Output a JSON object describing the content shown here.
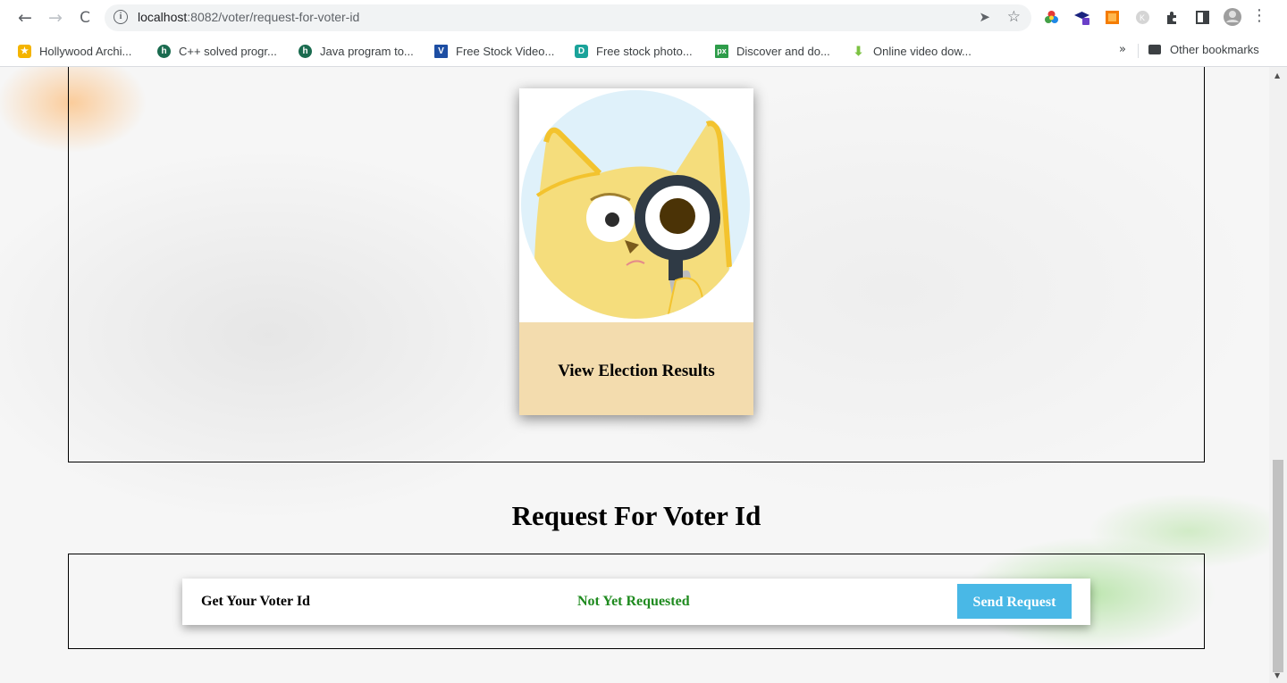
{
  "browser": {
    "url_host": "localhost",
    "url_rest": ":8082/voter/request-for-voter-id",
    "bookmarks": [
      {
        "label": "Hollywood Archi...",
        "icon": "hollywood-icon",
        "color": "#f4b400"
      },
      {
        "label": "C++ solved progr...",
        "icon": "cpp-site-icon",
        "color": "#1a6b4f"
      },
      {
        "label": "Java program to...",
        "icon": "java-site-icon",
        "color": "#1a6b4f"
      },
      {
        "label": "Free Stock Video...",
        "icon": "v-icon",
        "color": "#1d4ea3"
      },
      {
        "label": "Free stock photo...",
        "icon": "p-icon",
        "color": "#1aa39a"
      },
      {
        "label": "Discover and do...",
        "icon": "px-icon",
        "color": "#2e9c4a"
      },
      {
        "label": "Online video dow...",
        "icon": "download-arrow-icon",
        "color": "#7cc242"
      }
    ],
    "more_label": "»",
    "other_bookmarks": "Other bookmarks"
  },
  "card": {
    "caption": "View Election Results"
  },
  "section": {
    "title": "Request For Voter Id"
  },
  "request_row": {
    "label": "Get Your Voter Id",
    "status": "Not Yet Requested",
    "status_color": "#1e8a1e",
    "button_label": "Send Request",
    "button_color": "#49b8e6"
  }
}
